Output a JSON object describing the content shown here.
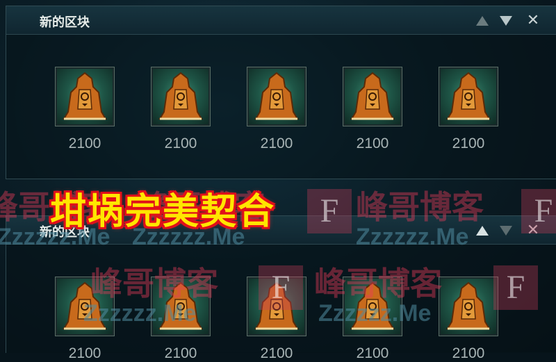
{
  "blocks": [
    {
      "title": "新的区块",
      "items": [
        {
          "icon": "bell-lantern-icon",
          "price": "2100"
        },
        {
          "icon": "bell-lantern-icon",
          "price": "2100"
        },
        {
          "icon": "bell-lantern-icon",
          "price": "2100"
        },
        {
          "icon": "bell-lantern-icon",
          "price": "2100"
        },
        {
          "icon": "bell-lantern-icon",
          "price": "2100"
        }
      ]
    },
    {
      "title": "新的区块",
      "items": [
        {
          "icon": "bell-lantern-icon",
          "price": "2100"
        },
        {
          "icon": "bell-lantern-icon",
          "price": "2100"
        },
        {
          "icon": "bell-lantern-icon",
          "price": "2100"
        },
        {
          "icon": "bell-lantern-icon",
          "price": "2100"
        },
        {
          "icon": "bell-lantern-icon",
          "price": "2100"
        }
      ]
    }
  ],
  "banner": "坩埚完美契合",
  "watermark": {
    "text": "峰哥博客",
    "sub": "Zzzzzz.Me",
    "logo": "F"
  },
  "colors": {
    "banner_fill": "#ffe600",
    "banner_stroke": "#e0101a",
    "header_bg": "#17343f"
  }
}
